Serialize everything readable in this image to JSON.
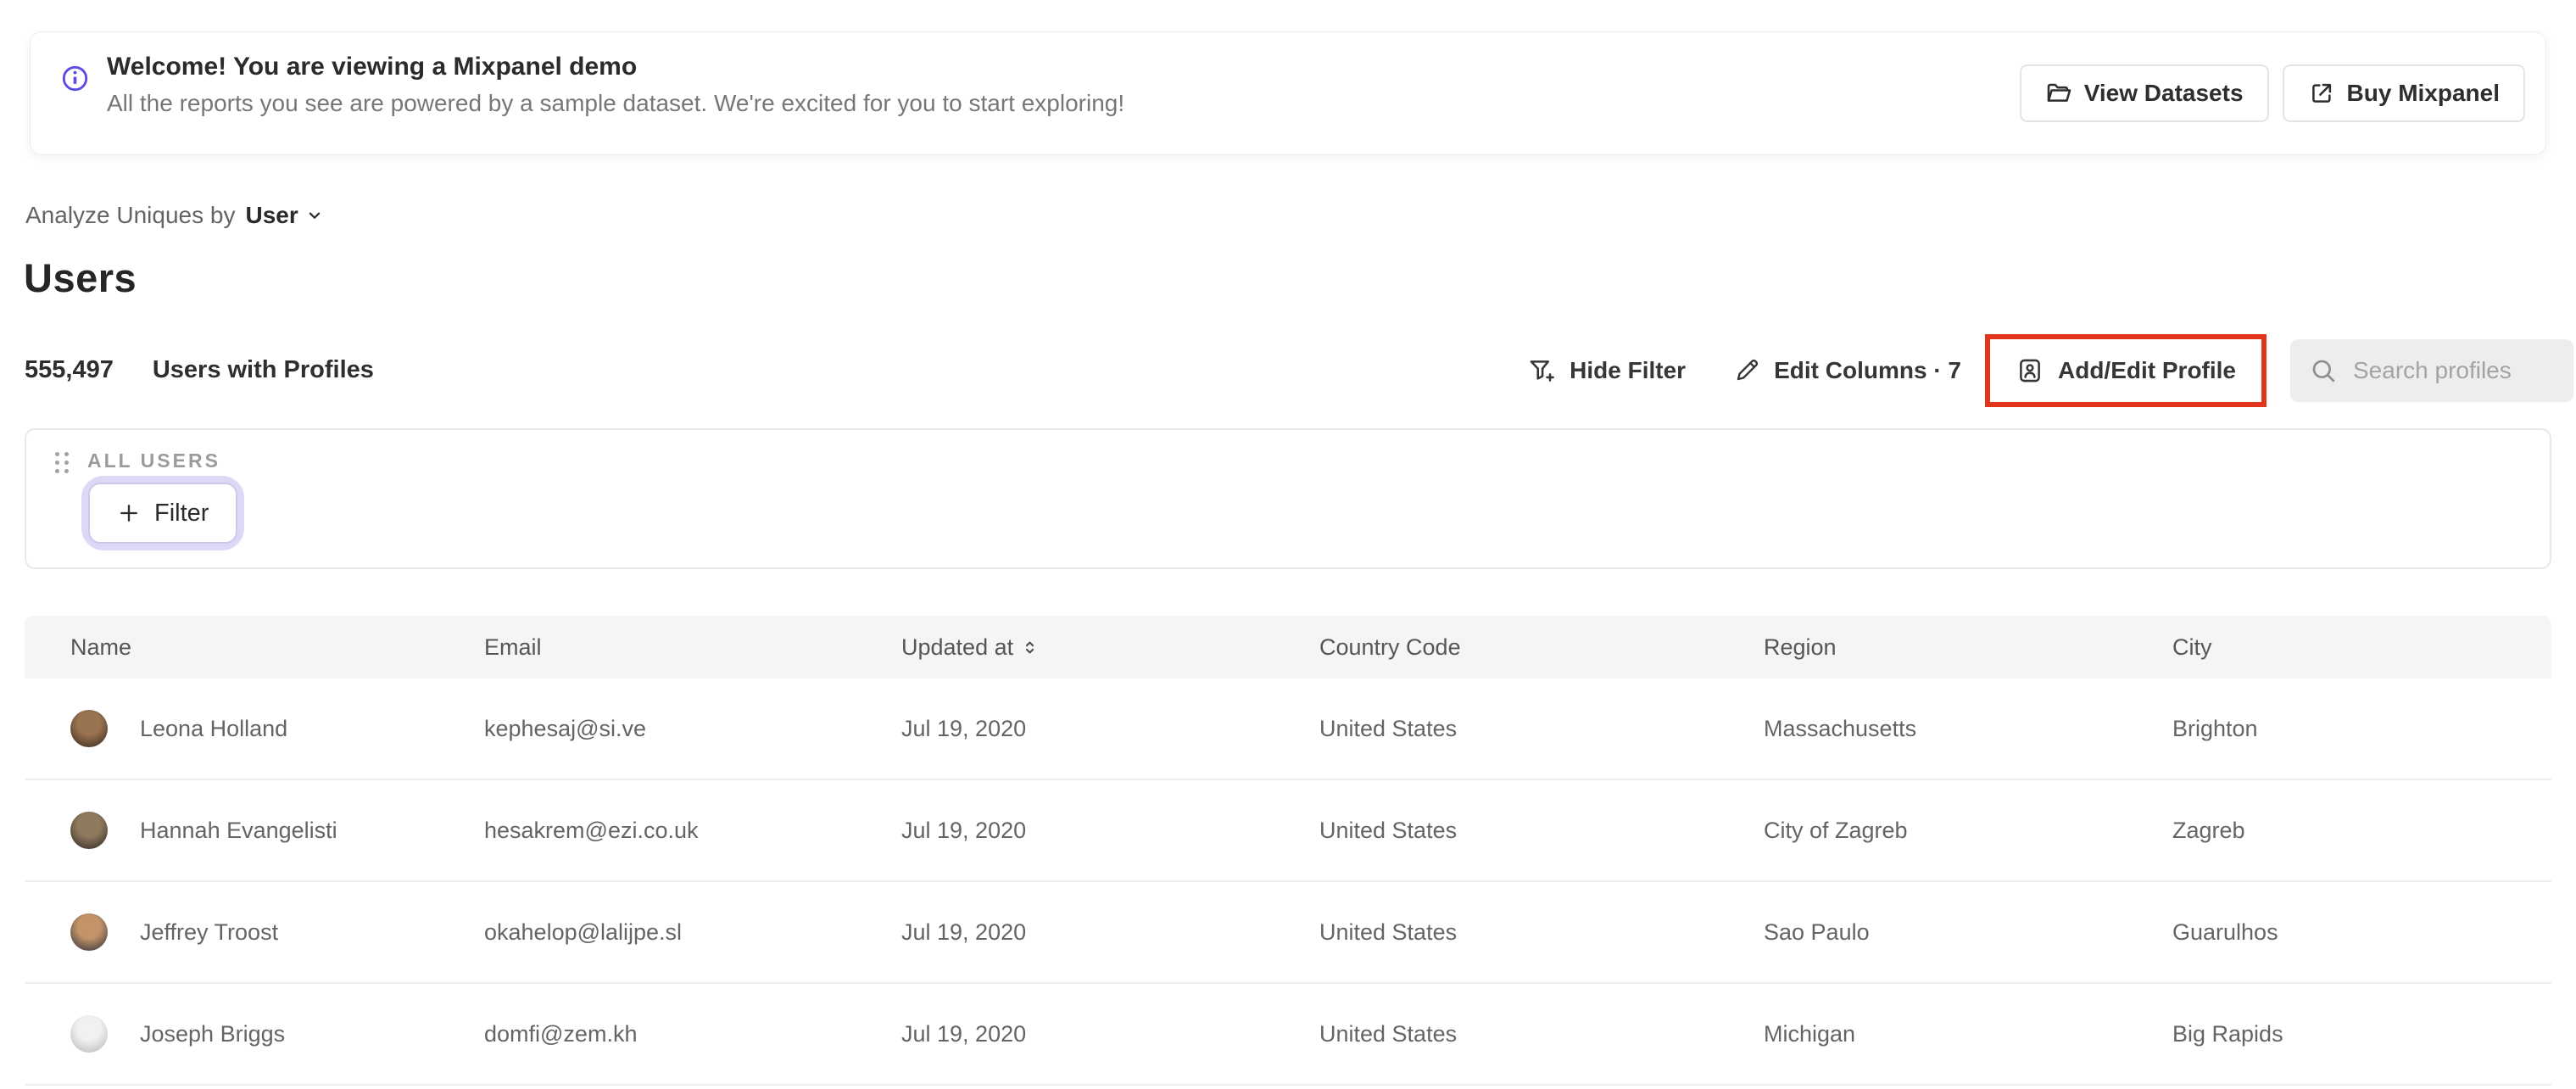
{
  "banner": {
    "title": "Welcome! You are viewing a Mixpanel demo",
    "subtitle": "All the reports you see are powered by a sample dataset. We're excited for you to start exploring!",
    "view_datasets_label": "View Datasets",
    "buy_mixpanel_label": "Buy Mixpanel"
  },
  "subheader": {
    "analyze_label": "Analyze Uniques by",
    "analyze_value": "User"
  },
  "page_title": "Users",
  "stats": {
    "count": "555,497",
    "label": "Users with Profiles"
  },
  "toolbar": {
    "hide_filter_label": "Hide Filter",
    "edit_columns_label": "Edit Columns · 7",
    "add_edit_profile_label": "Add/Edit Profile",
    "search_placeholder": "Search profiles"
  },
  "filter_panel": {
    "group_label": "ALL USERS",
    "add_filter_label": "Filter"
  },
  "table": {
    "columns": [
      "Name",
      "Email",
      "Updated at",
      "Country Code",
      "Region",
      "City"
    ],
    "rows": [
      {
        "name": "Leona Holland",
        "email": "kephesaj@si.ve",
        "updated_at": "Jul 19, 2020",
        "country_code": "United States",
        "region": "Massachusetts",
        "city": "Brighton",
        "avatar_colors": [
          "#9a7350",
          "#32241a"
        ]
      },
      {
        "name": "Hannah Evangelisti",
        "email": "hesakrem@ezi.co.uk",
        "updated_at": "Jul 19, 2020",
        "country_code": "United States",
        "region": "City of Zagreb",
        "city": "Zagreb",
        "avatar_colors": [
          "#8f7a5e",
          "#2a2522"
        ]
      },
      {
        "name": "Jeffrey Troost",
        "email": "okahelop@lalijpe.sl",
        "updated_at": "Jul 19, 2020",
        "country_code": "United States",
        "region": "Sao Paulo",
        "city": "Guarulhos",
        "avatar_colors": [
          "#c3936a",
          "#262b34"
        ]
      },
      {
        "name": "Joseph Briggs",
        "email": "domfi@zem.kh",
        "updated_at": "Jul 19, 2020",
        "country_code": "United States",
        "region": "Michigan",
        "city": "Big Rapids",
        "avatar_colors": [
          "#f1f1f1",
          "#b4b4b4"
        ]
      }
    ]
  },
  "colors": {
    "info_accent": "#5b4be0",
    "highlight_red": "#e0351b",
    "filter_ring": "#dcd9f7",
    "search_bg": "#ededed",
    "table_header_bg": "#f5f5f6"
  }
}
